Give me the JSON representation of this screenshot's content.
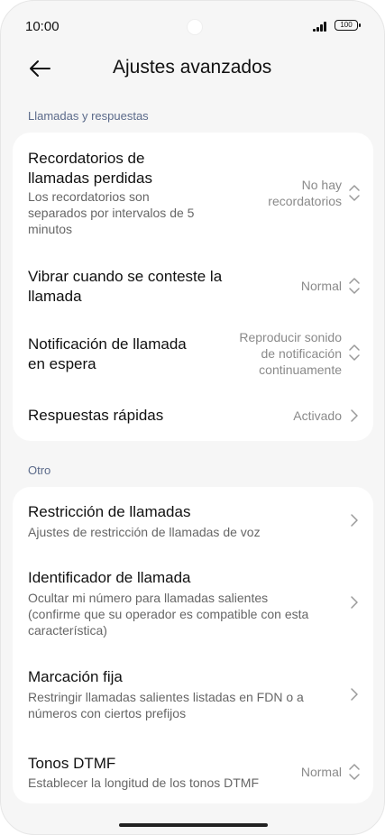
{
  "status": {
    "time": "10:00",
    "battery": "100"
  },
  "header": {
    "title": "Ajustes avanzados"
  },
  "sections": [
    {
      "label": "Llamadas y respuestas",
      "items": [
        {
          "title_lines": [
            "Recordatorios de",
            "llamadas perdidas"
          ],
          "subtitle_lines": [
            "Los recordatorios son",
            "separados por intervalos de 5",
            "minutos"
          ],
          "value_lines": [
            "No hay",
            "recordatorios"
          ],
          "control": "updown-icon"
        },
        {
          "title_lines": [
            "Vibrar cuando se conteste la",
            "llamada"
          ],
          "value_lines": [
            "Normal"
          ],
          "control": "updown-icon"
        },
        {
          "title_lines": [
            "Notificación de llamada",
            "en espera"
          ],
          "value_lines": [
            "Reproducir sonido",
            "de notificación",
            "continuamente"
          ],
          "control": "updown-icon"
        },
        {
          "title_lines": [
            "Respuestas rápidas"
          ],
          "value_lines": [
            "Activado"
          ],
          "control": "chevron-right-icon"
        }
      ]
    },
    {
      "label": "Otro",
      "items": [
        {
          "title_lines": [
            "Restricción de llamadas"
          ],
          "subtitle_lines": [
            "Ajustes de restricción de llamadas de voz"
          ],
          "control": "chevron-right-icon"
        },
        {
          "title_lines": [
            "Identificador de llamada"
          ],
          "subtitle_lines": [
            "Ocultar mi número para llamadas salientes",
            "(confirme que su operador es compatible con esta",
            "característica)"
          ],
          "control": "chevron-right-icon"
        },
        {
          "title_lines": [
            "Marcación fija"
          ],
          "subtitle_lines": [
            "Restringir llamadas salientes listadas en FDN o a",
            "números con ciertos prefijos"
          ],
          "control": "chevron-right-icon"
        },
        {
          "title_lines": [
            "Tonos DTMF"
          ],
          "subtitle_lines": [
            "Establecer la longitud de los tonos DTMF"
          ],
          "value_lines": [
            "Normal"
          ],
          "control": "updown-icon"
        }
      ]
    }
  ]
}
